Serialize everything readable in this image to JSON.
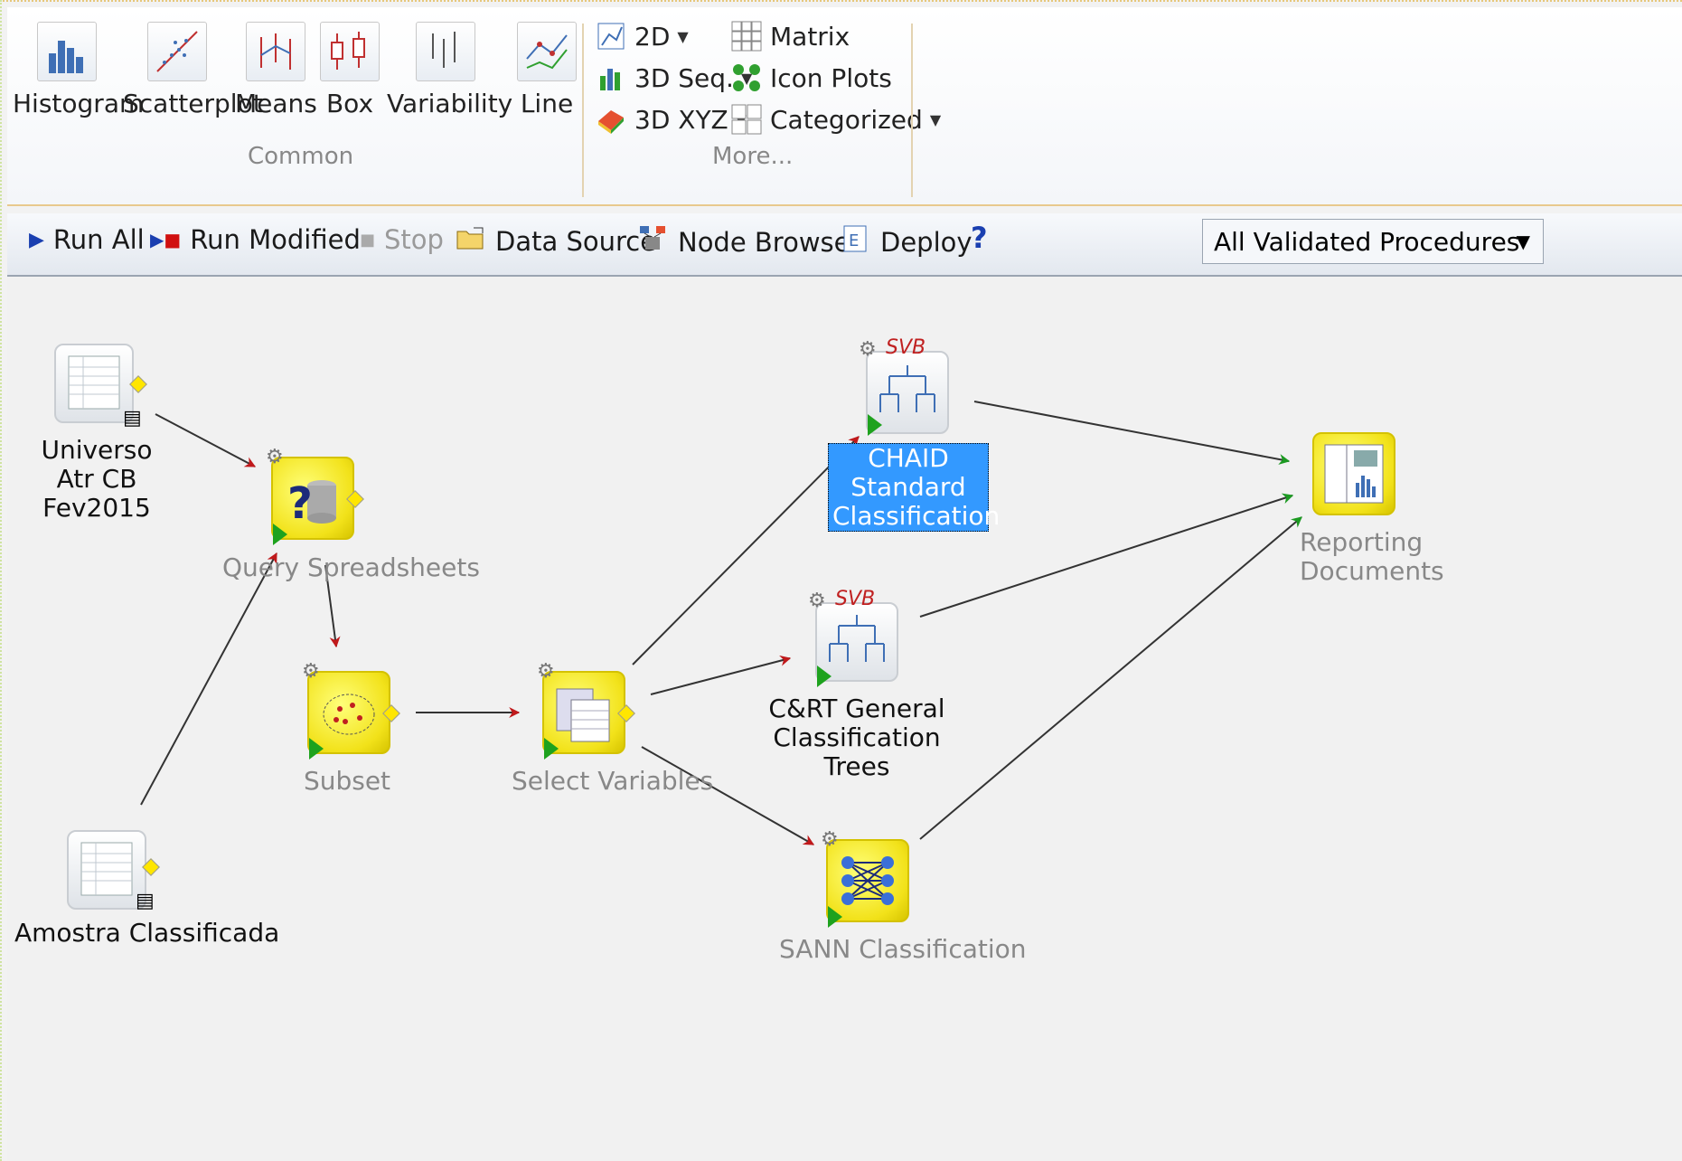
{
  "ribbon": {
    "common_buttons": [
      {
        "label": "Histogram"
      },
      {
        "label": "Scatterplot"
      },
      {
        "label": "Means"
      },
      {
        "label": "Box"
      },
      {
        "label": "Variability"
      },
      {
        "label": "Line"
      }
    ],
    "common_group_label": "Common",
    "more_buttons": [
      {
        "label": "2D"
      },
      {
        "label": "3D Seq."
      },
      {
        "label": "3D XYZ"
      },
      {
        "label": "Matrix"
      },
      {
        "label": "Icon Plots"
      },
      {
        "label": "Categorized"
      }
    ],
    "more_group_label": "More..."
  },
  "toolbar": {
    "run_all": "Run All",
    "run_modified": "Run Modified",
    "stop": "Stop",
    "data_source": "Data Source",
    "node_browser": "Node Browser",
    "deploy": "Deploy",
    "help": "?",
    "procedures_select": "All Validated Procedures"
  },
  "nodes": {
    "universo": "Universo Atr CB\nFev2015",
    "query": "Query Spreadsheets",
    "subset": "Subset",
    "amostra": "Amostra Classificada",
    "select_vars": "Select Variables",
    "chaid": "CHAID Standard\nClassification",
    "chaid_badge": "SVB",
    "cart": "C&RT General\nClassification Trees",
    "cart_badge": "SVB",
    "sann": "SANN Classification",
    "reporting": "Reporting\nDocuments"
  },
  "colors": {
    "arrow_red": "#c0191b",
    "arrow_green": "#1c9a22",
    "selection": "#3399ff"
  }
}
